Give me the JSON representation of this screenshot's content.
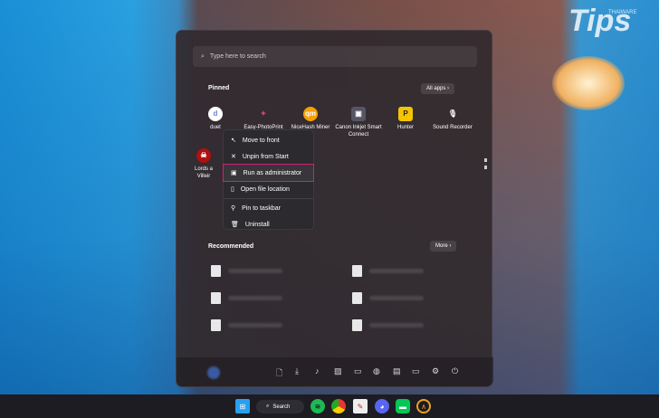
{
  "brand": {
    "logo": "Tips",
    "sublogo": "THAIWARE"
  },
  "search": {
    "placeholder": "Type here to search"
  },
  "pinned": {
    "title": "Pinned",
    "all_apps": "All apps",
    "apps": [
      {
        "name": "duet",
        "glyph": "d",
        "color": "#ffffff"
      },
      {
        "name": "Easy-PhotoPrint",
        "glyph": "✦",
        "color": "#e04080"
      },
      {
        "name": "NiceHash Miner",
        "glyph": "qm",
        "color": "#f5a000"
      },
      {
        "name": "Canon Inkjet Smart Connect",
        "glyph": "▣",
        "color": "#556"
      },
      {
        "name": "Hunter",
        "glyph": "P",
        "color": "#f5c400"
      },
      {
        "name": "Sound Recorder",
        "glyph": "🎙",
        "color": "#888"
      },
      {
        "name": "Lords a Villeir",
        "glyph": "☠",
        "color": "#b01010"
      }
    ]
  },
  "context_menu": {
    "items": [
      "Move to front",
      "Unpin from Start",
      "Run as administrator",
      "Open file location",
      "Pin to taskbar",
      "Uninstall"
    ],
    "highlighted": "Run as administrator"
  },
  "recommended": {
    "title": "Recommended",
    "more": "More"
  },
  "taskbar": {
    "search": "Search"
  },
  "colors": {
    "highlight": "#d0207a"
  }
}
